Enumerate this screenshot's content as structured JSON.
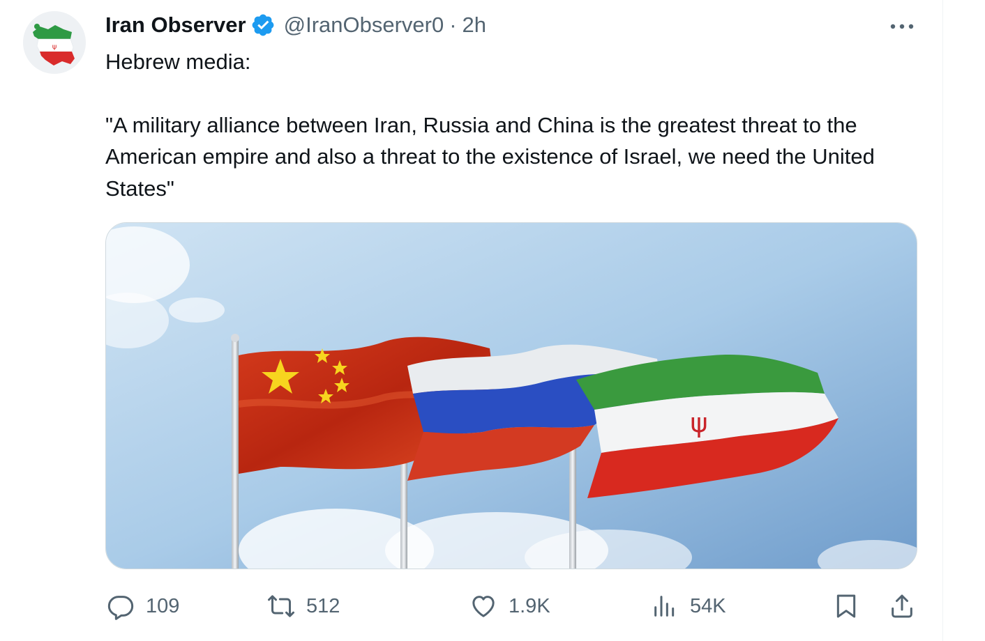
{
  "tweet": {
    "display_name": "Iran Observer",
    "handle": "@IranObserver0",
    "separator": "·",
    "time": "2h",
    "text_line1": "Hebrew media:",
    "text_quote": "\"A military alliance between Iran, Russia and China is the greatest threat to the American empire and also a threat to the existence of Israel, we need the United States\""
  },
  "actions": {
    "replies": "109",
    "reposts": "512",
    "likes": "1.9K",
    "views": "54K"
  },
  "icons": {
    "verified": "verified-badge-icon",
    "more": "more-dots-icon",
    "reply": "reply-bubble-icon",
    "repost": "repost-icon",
    "like": "heart-icon",
    "views": "views-bar-chart-icon",
    "bookmark": "bookmark-icon",
    "share": "share-icon"
  },
  "colors": {
    "verified_blue": "#1d9bf0",
    "secondary_text": "#536471",
    "primary_text": "#0f1419"
  }
}
